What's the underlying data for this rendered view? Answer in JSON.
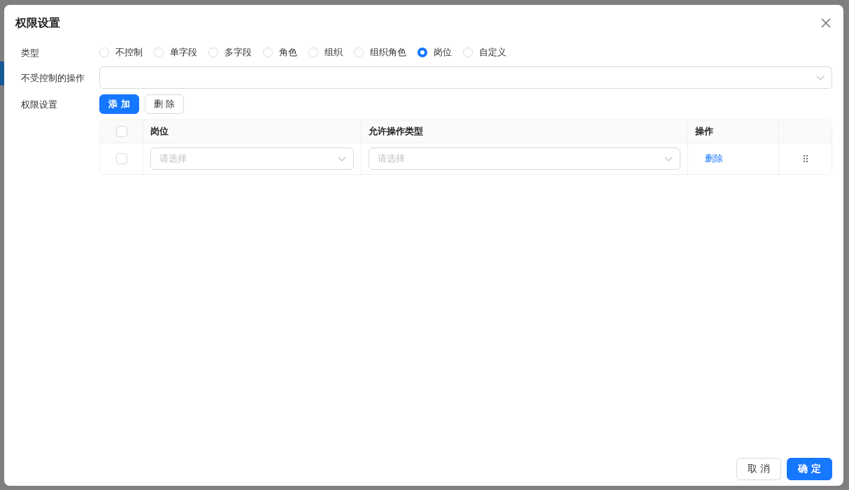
{
  "dialog": {
    "title": "权限设置"
  },
  "form": {
    "type_label": "类型",
    "type_options": [
      {
        "label": "不控制",
        "selected": false
      },
      {
        "label": "单字段",
        "selected": false
      },
      {
        "label": "多字段",
        "selected": false
      },
      {
        "label": "角色",
        "selected": false
      },
      {
        "label": "组织",
        "selected": false
      },
      {
        "label": "组织角色",
        "selected": false
      },
      {
        "label": "岗位",
        "selected": true
      },
      {
        "label": "自定义",
        "selected": false
      }
    ],
    "uncontrolled_label": "不受控制的操作",
    "permission_label": "权限设置",
    "add_button": "添 加",
    "delete_button": "删 除"
  },
  "table": {
    "columns": [
      "岗位",
      "允许操作类型",
      "操作"
    ],
    "header_checked": false,
    "rows": [
      {
        "checked": false,
        "post_placeholder": "请选择",
        "ops_placeholder": "请选择",
        "action": "删除"
      }
    ]
  },
  "footer": {
    "buttons": [
      {
        "label": "取 消",
        "kind": "default"
      },
      {
        "label": "确 定",
        "kind": "primary"
      }
    ]
  }
}
